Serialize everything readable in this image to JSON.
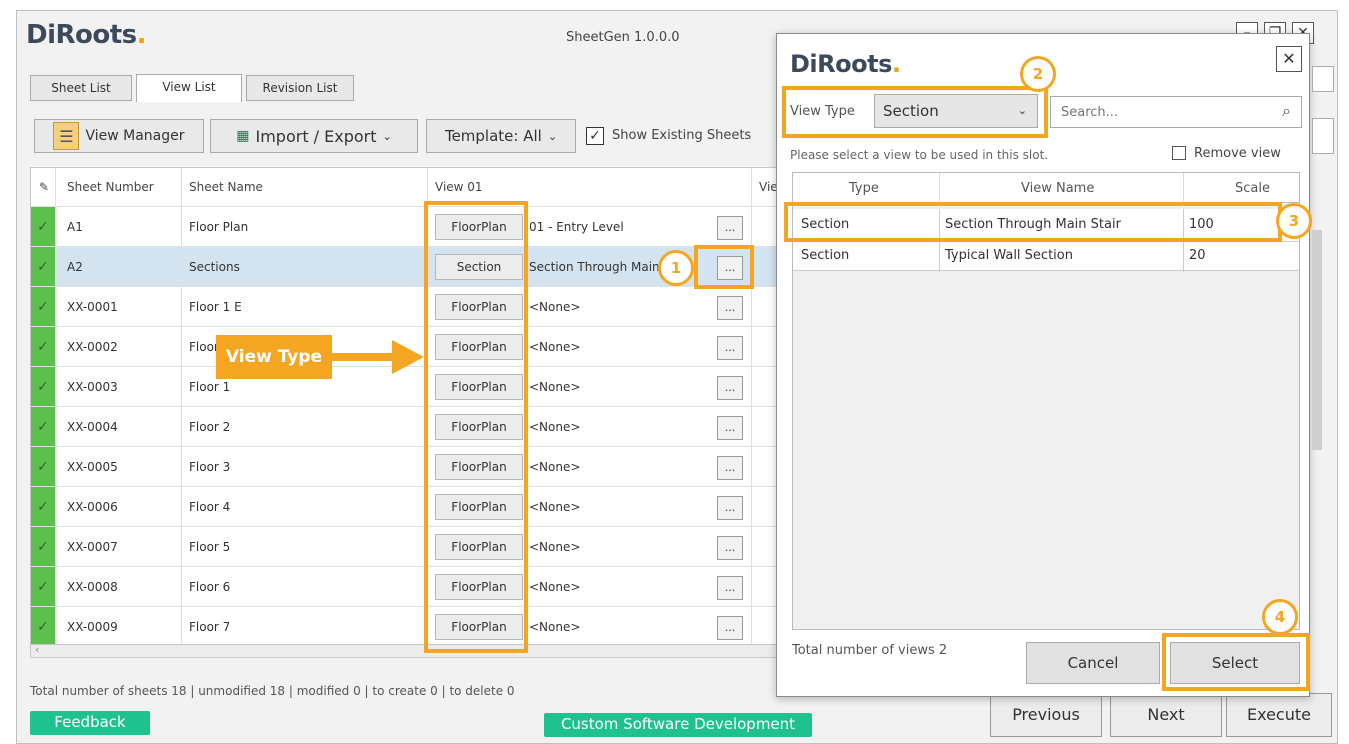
{
  "app": {
    "logo": "DiRoots",
    "title": "SheetGen 1.0.0.0"
  },
  "tabs": [
    "Sheet List",
    "View List",
    "Revision List"
  ],
  "toolbar": {
    "view_manager": "View Manager",
    "import_export": "Import / Export",
    "template": "Template: All",
    "show_existing": "Show Existing Sheets",
    "show_existing_checked": true
  },
  "grid": {
    "headers": [
      "Sheet Number",
      "Sheet Name",
      "View 01",
      "Vie"
    ],
    "rows": [
      {
        "number": "A1",
        "name": "Floor Plan",
        "type": "FloorPlan",
        "view": "01 - Entry Level"
      },
      {
        "number": "A2",
        "name": "Sections",
        "type": "Section",
        "view": "Section Through Main Stair"
      },
      {
        "number": "XX-0001",
        "name": "Floor 1 E",
        "type": "FloorPlan",
        "view": "<None>"
      },
      {
        "number": "XX-0002",
        "name": "Floor",
        "type": "FloorPlan",
        "view": "<None>"
      },
      {
        "number": "XX-0003",
        "name": "Floor 1",
        "type": "FloorPlan",
        "view": "<None>"
      },
      {
        "number": "XX-0004",
        "name": "Floor 2",
        "type": "FloorPlan",
        "view": "<None>"
      },
      {
        "number": "XX-0005",
        "name": "Floor 3",
        "type": "FloorPlan",
        "view": "<None>"
      },
      {
        "number": "XX-0006",
        "name": "Floor 4",
        "type": "FloorPlan",
        "view": "<None>"
      },
      {
        "number": "XX-0007",
        "name": "Floor 5",
        "type": "FloorPlan",
        "view": "<None>"
      },
      {
        "number": "XX-0008",
        "name": "Floor 6",
        "type": "FloorPlan",
        "view": "<None>"
      },
      {
        "number": "XX-0009",
        "name": "Floor 7",
        "type": "FloorPlan",
        "view": "<None>"
      }
    ],
    "browse_label": "..."
  },
  "status": "Total number of sheets 18 | unmodified 18 | modified 0 | to create 0 | to delete 0",
  "footer": {
    "feedback": "Feedback",
    "custom_dev": "Custom Software Development",
    "previous": "Previous",
    "next": "Next",
    "execute": "Execute"
  },
  "annotation": {
    "view_type_label": "View Type",
    "steps": [
      "1",
      "2",
      "3",
      "4"
    ]
  },
  "dialog": {
    "logo": "DiRoots",
    "view_type_label": "View Type",
    "view_type_value": "Section",
    "search_placeholder": "Search...",
    "instruction": "Please select a view to be used in this slot.",
    "remove_view": "Remove view",
    "columns": [
      "Type",
      "View Name",
      "Scale"
    ],
    "rows": [
      {
        "type": "Section",
        "name": "Section Through Main Stair",
        "scale": "100"
      },
      {
        "type": "Section",
        "name": "Typical Wall Section",
        "scale": "20"
      }
    ],
    "total": "Total number of views 2",
    "cancel": "Cancel",
    "select": "Select"
  },
  "colors": {
    "accent": "#f4a623",
    "check_green": "#5cbf4e",
    "selected_row": "#d3e3ef",
    "green_button": "#1fc28e"
  }
}
